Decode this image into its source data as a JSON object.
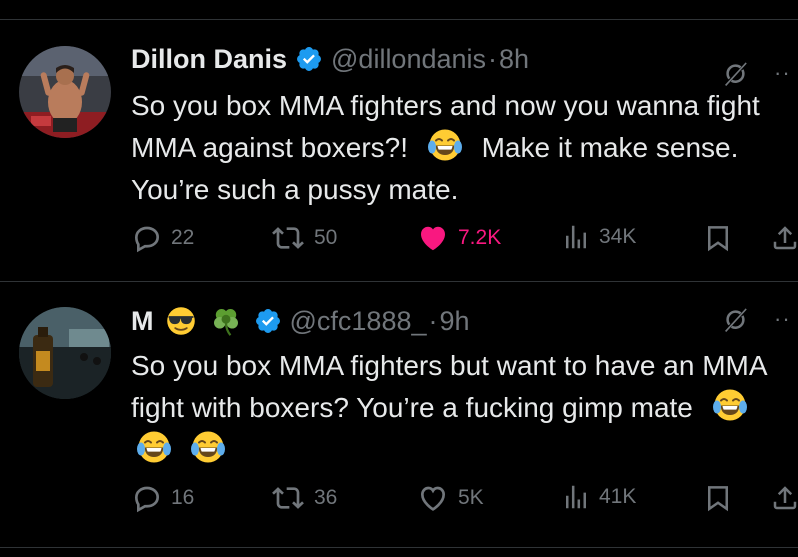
{
  "tweets": [
    {
      "name": "Dillon Danis",
      "handle": "@dillondanis",
      "separator": "·",
      "time": "8h",
      "text_parts": [
        "So you box MMA fighters and now you wanna fight MMA against boxers?!",
        "Make it make sense. You’re such a pussy mate."
      ],
      "replies": "22",
      "retweets": "50",
      "likes": "7.2K",
      "views": "34K",
      "liked": true
    },
    {
      "name": "M",
      "handle": "@cfc1888_",
      "separator": "·",
      "time": "9h",
      "text": "So you box MMA fighters but want to have an MMA fight with boxers? You’re a fucking gimp mate",
      "replies": "16",
      "retweets": "36",
      "likes": "5K",
      "views": "41K",
      "liked": false
    }
  ],
  "colors": {
    "background": "#000000",
    "text": "#e7e9ea",
    "secondary": "#71767b",
    "verified": "#1d9bf0",
    "like": "#f91880",
    "divider": "#2f3336"
  },
  "icons": [
    "verified-badge-icon",
    "grok-icon",
    "more-icon",
    "reply-icon",
    "retweet-icon",
    "like-icon",
    "views-icon",
    "bookmark-icon",
    "share-icon",
    "tears-of-joy-emoji",
    "sunglasses-emoji",
    "four-leaf-clover-emoji"
  ]
}
